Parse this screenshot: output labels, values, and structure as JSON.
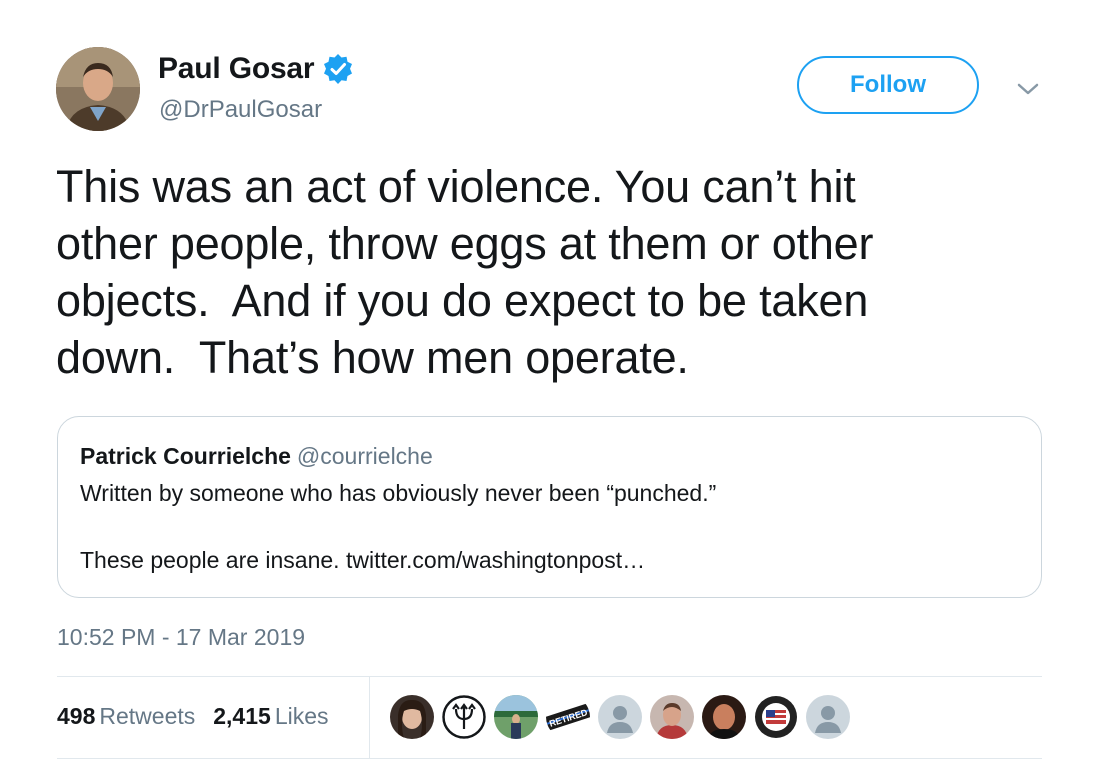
{
  "author": {
    "display_name": "Paul Gosar",
    "handle": "@DrPaulGosar",
    "verified": true,
    "avatar_icon": "author-avatar"
  },
  "follow_label": "Follow",
  "menu_icon": "chevron-down-icon",
  "tweet_text": "This was an act of violence. You can’t hit\nother people, throw eggs at them or other\nobjects.  And if you do expect to be taken\ndown.  That’s how men operate.",
  "quoted_tweet": {
    "display_name": "Patrick Courrielche",
    "handle": "@courrielche",
    "line1": "Written by someone who has obviously never been “punched.”",
    "line2": "These people are insane. twitter.com/washingtonpost…"
  },
  "timestamp": "10:52 PM - 17 Mar 2019",
  "stats": {
    "retweets_count": "498",
    "retweets_label": "Retweets",
    "likes_count": "2,415",
    "likes_label": "Likes"
  },
  "likers": [
    {
      "icon": "liker-avatar-woman"
    },
    {
      "icon": "liker-avatar-trident"
    },
    {
      "icon": "liker-avatar-field"
    },
    {
      "icon": "liker-avatar-retired-badge"
    },
    {
      "icon": "liker-avatar-default"
    },
    {
      "icon": "liker-avatar-man-red"
    },
    {
      "icon": "liker-avatar-man-dark"
    },
    {
      "icon": "liker-avatar-flag-seal"
    },
    {
      "icon": "liker-avatar-default"
    }
  ],
  "colors": {
    "accent": "#1da1f2",
    "text_primary": "#14171a",
    "text_secondary": "#657786",
    "border": "#ccd6dd"
  }
}
